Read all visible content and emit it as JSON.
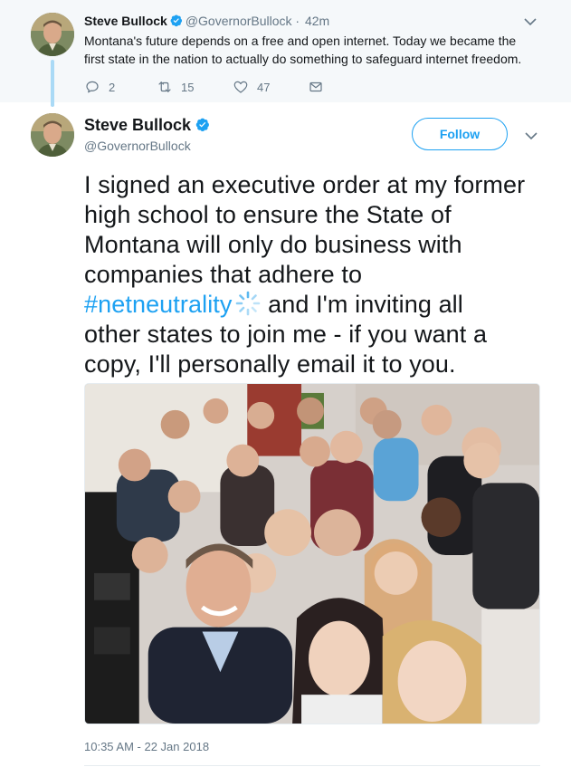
{
  "parent_tweet": {
    "author_name": "Steve Bullock",
    "handle": "@GovernorBullock",
    "separator": "·",
    "time": "42m",
    "text": "Montana's future depends on a free and open internet. Today we became the first state in the nation to actually do something to safeguard internet freedom.",
    "reply_count": "2",
    "retweet_count": "15",
    "like_count": "47"
  },
  "main_tweet": {
    "author_name": "Steve Bullock",
    "handle": "@GovernorBullock",
    "follow_label": "Follow",
    "text_lines": {
      "l1": "I signed an executive order at my former",
      "l2": "high school to ensure the State of",
      "l3": "Montana will only do business with",
      "l4": "companies that adhere to",
      "l5_hashtag": "#netneutrality",
      "l5_rest": " and I'm inviting all",
      "l6": "other states to join me - if you want a",
      "l7": "copy, I'll personally email it to you."
    },
    "timestamp": "10:35 AM - 22 Jan 2018"
  },
  "icons": {
    "verified": "verified-badge-icon",
    "caret": "chevron-down-icon",
    "reply": "reply-icon",
    "retweet": "retweet-icon",
    "like": "heart-icon",
    "message": "envelope-icon",
    "hashtag_emoji": "netneutrality-spinner-icon"
  },
  "colors": {
    "accent": "#1da1f2",
    "muted_text": "#657786",
    "thread_line": "#aadaf6",
    "parent_bg": "#f5f8fa"
  }
}
